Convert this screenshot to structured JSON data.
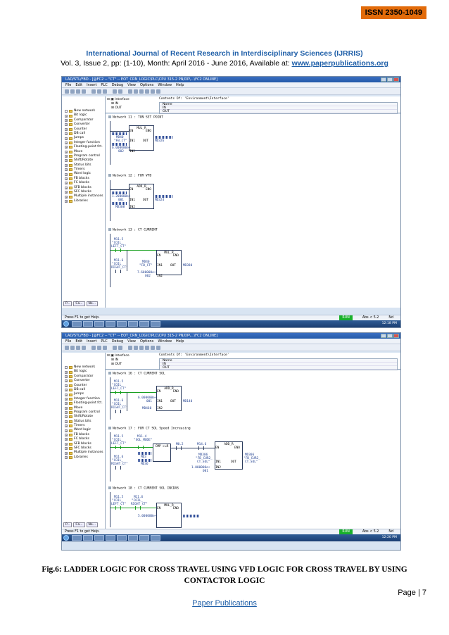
{
  "header": {
    "issn": "ISSN 2350-1049",
    "journal": "International Journal of Recent Research in Interdisciplinary Sciences (IJRRIS)",
    "vol_text": "Vol. 3, Issue 2, pp: (1-10), Month: April 2016 - June 2016, Available at: ",
    "url": "www.paperpublications.org"
  },
  "shot1": {
    "title": "LAD/STL/FBD - [@FC2 -- \"CT\" -- EOT_CRN_LOGIC\\PLC\\CPU 315-2 PN/DP\\...\\FC2 ONLINE]",
    "menu": [
      "File",
      "Edit",
      "Insert",
      "PLC",
      "Debug",
      "View",
      "Options",
      "Window",
      "Help"
    ],
    "iface": {
      "root": "Interface",
      "in": "IN",
      "out": "OUT",
      "contents": "Contents Of: 'Environment\\Interface'",
      "name": "Name",
      "n_in": "IN",
      "n_out": "OUT"
    },
    "tree": [
      "New network",
      "Bit logic",
      "Comparator",
      "Converter",
      "Counter",
      "DB call",
      "Jumps",
      "Integer function",
      "Floating-point fct.",
      "Move",
      "Program control",
      "Shift/Rotate",
      "Status bits",
      "Timers",
      "Word logic",
      "FB blocks",
      "FC blocks",
      "SFB blocks",
      "SFC blocks",
      "Multiple instances",
      "Libraries"
    ],
    "tabs": [
      "P...",
      "Ca...",
      "Ne..."
    ],
    "networks": [
      {
        "title": "Network 11 : TON SET POINT",
        "block": "MUL_R",
        "en": "EN",
        "eno": "ENO",
        "in1_val": "MD40",
        "in1_sym": "\"FB_CT\"",
        "in1": "IN1",
        "out": "OUT",
        "out_dst": "MD326",
        "in2_val": "6.000000e+",
        "in2_sym": "002",
        "in2": "IN2"
      },
      {
        "title": "Network 12 : FOR VFD",
        "block": "ADD_R",
        "en": "EN",
        "eno": "ENO",
        "in1_val": "1.200000e+",
        "in1_sym": "001",
        "in1": "IN1",
        "out": "OUT",
        "out_dst": "MD324",
        "in2_sym": "MD308",
        "in2": "IN2"
      },
      {
        "title": "Network 13 : CT CURRENT",
        "c1": "M11.5",
        "c1_sym": "\"COIL_",
        "c1_sym2": "LEFT_CT\"",
        "c2": "M11.6",
        "c2_sym": "\"COIL_",
        "c2_sym2": "RIGHT_CT\"",
        "block": "MUL_R",
        "en": "EN",
        "eno": "ENO",
        "in1_val": "MD40",
        "in1_sym": "\"FB_CT\"",
        "in1": "IN1",
        "out": "OUT",
        "out_dst": "MD380",
        "in2_val": "7.600000e+",
        "in2_sym": "002",
        "in2": "IN2"
      }
    ],
    "status": {
      "help": "Press F1 to get Help.",
      "run": "RUN",
      "abs": "Abs < 5.2",
      "nd": "Nd"
    },
    "clock": "12:18 PM"
  },
  "shot2": {
    "title": "LAD/STL/FBD - [@FC2 -- \"CT\" -- EOT_CRN_LOGIC\\PLC\\CPU 315-2 PN/DP\\...\\FC2 ONLINE]",
    "menu": [
      "File",
      "Edit",
      "Insert",
      "PLC",
      "Debug",
      "View",
      "Options",
      "Window",
      "Help"
    ],
    "iface": {
      "root": "Interface",
      "in": "IN",
      "out": "OUT",
      "contents": "Contents Of: 'Environment\\Interface'",
      "name": "Name",
      "n_in": "IN",
      "n_out": "OUT"
    },
    "tree": [
      "New network",
      "Bit logic",
      "Comparator",
      "Converter",
      "Counter",
      "DB call",
      "Jumps",
      "Integer function",
      "Floating-point fct.",
      "Move",
      "Program control",
      "Shift/Rotate",
      "Status bits",
      "Timers",
      "Word logic",
      "FB blocks",
      "FC blocks",
      "SFB blocks",
      "SFC blocks",
      "Multiple instances",
      "Libraries"
    ],
    "tabs": [
      "P...",
      "Ca...",
      "Ne..."
    ],
    "networks": [
      {
        "title": "Network 16 : CT CURRENT SOL",
        "c1": "M11.5",
        "c1_sym": "\"COIL_",
        "c1_sym2": "LEFT_CT\"",
        "c2": "M11.6",
        "c2_sym": "\"COIL_",
        "c2_sym2": "RIGHT_CT\"",
        "block": "ADD_R",
        "en": "EN",
        "eno": "ENO",
        "in1_val": "6.000000e+",
        "in1_sym": "001",
        "in1": "IN1",
        "out": "OUT",
        "out_dst": "MD140",
        "in2_sym": "MD460",
        "in2": "IN2"
      },
      {
        "title": "Network 17 : FOR CT SOL Speed Increasing",
        "c1": "M11.5",
        "c1_sym": "\"COIL_",
        "c1_sym2": "LEFT_CT\"",
        "c3": "M11.4",
        "c3_sym": "\"SOL_MODE\"",
        "cmp": "CMP >=R",
        "c2": "M11.6",
        "c2_sym": "\"COIL_",
        "c2_sym2": "RIGHT_CT\"",
        "md3": "MD3",
        "md3b": "MD36",
        "m02": "M0.2",
        "m_k": "M14.6",
        "block": "ADD_R",
        "en": "EN",
        "eno": "ENO",
        "in1_sym": "MD306",
        "in1_sym2": "\"FB_CUR2_",
        "in1_sym3": "CT_SOL\"",
        "in1": "IN1",
        "out": "OUT",
        "out_dst": "MD306",
        "out_sym": "\"FB_CUR2_",
        "out_sym2": "CT_SOL\"",
        "in2_val": "1.000000e+",
        "in2_sym": "001",
        "in2": "IN2"
      },
      {
        "title": "Network 18 : CT CURRENT SOL INCDAS",
        "c1": "M11.5",
        "c1_sym": "\"COIL_",
        "c1_sym2": "LEFT_CT\"",
        "c2": "M11.6",
        "c2_sym": "\"COIL_",
        "c2_sym2": "RIGHT_CT\"",
        "block": "MUL_R",
        "en": "EN",
        "eno": "ENO",
        "in2_val": "5.000000e+"
      }
    ],
    "status": {
      "help": "Press F1 to get Help.",
      "run": "RUN",
      "abs": "Abs < 5.2",
      "nd": "Nd"
    },
    "clock": "12:20 PM"
  },
  "caption": "Fig.6: LADDER LOGIC FOR CROSS TRAVEL USING VFD LOGIC FOR CROSS TRAVEL BY USING CONTACTOR LOGIC",
  "footer": {
    "page": "Page | 7",
    "publisher": "Paper Publications"
  }
}
